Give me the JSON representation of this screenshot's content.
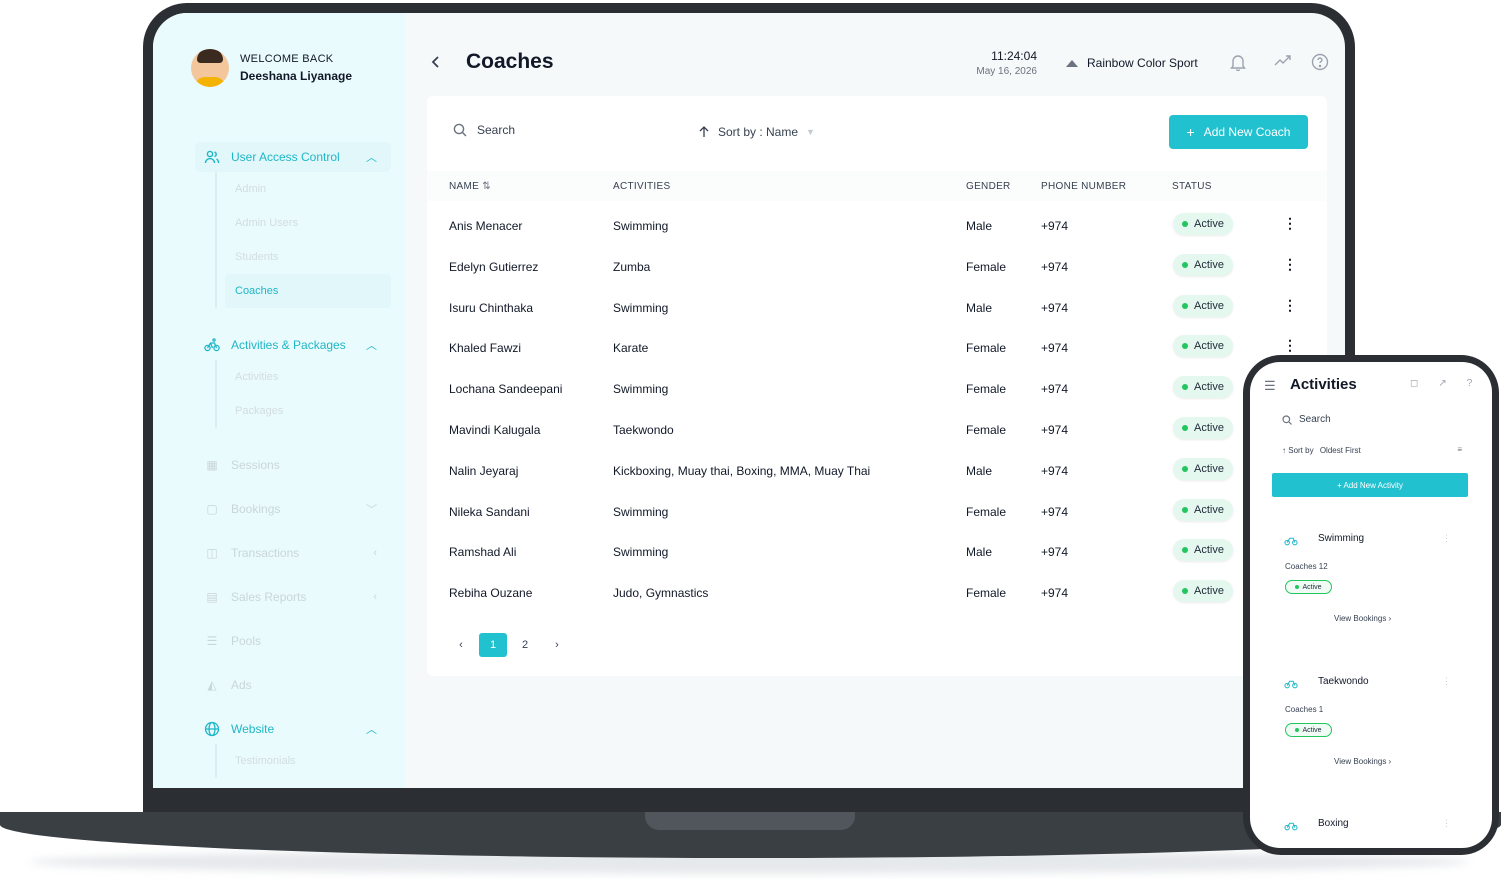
{
  "sidebar": {
    "welcome": "WELCOME BACK",
    "username": "Deeshana Liyanage",
    "groups": [
      {
        "label": "User Access Control",
        "icon": "users-icon",
        "sub": [
          "Admin",
          "Admin Users",
          "Students",
          "Coaches"
        ]
      },
      {
        "label": "Activities & Packages",
        "icon": "bike-icon",
        "sub": [
          "Activities",
          "Packages"
        ]
      },
      {
        "label": "Sessions",
        "icon": "grid-icon"
      },
      {
        "label": "Bookings",
        "icon": "calendar-icon"
      },
      {
        "label": "Transactions",
        "icon": "wallet-icon"
      },
      {
        "label": "Sales Reports",
        "icon": "report-icon"
      },
      {
        "label": "Pools",
        "icon": "list-icon"
      },
      {
        "label": "Ads",
        "icon": "megaphone-icon"
      },
      {
        "label": "Website",
        "icon": "globe-icon",
        "sub": [
          "Testimonials"
        ]
      }
    ]
  },
  "header": {
    "title": "Coaches",
    "time": "11:24:04",
    "date": "May 16, 2026",
    "org": "Rainbow Color Sport"
  },
  "toolbar": {
    "search_placeholder": "Search",
    "sort_label": "Sort by : Name",
    "add_label": "Add New Coach"
  },
  "table": {
    "columns": [
      "NAME",
      "ACTIVITIES",
      "GENDER",
      "PHONE NUMBER",
      "STATUS"
    ],
    "rows": [
      {
        "name": "Anis Menacer",
        "activities": "Swimming",
        "gender": "Male",
        "phone": "+974",
        "status": "Active"
      },
      {
        "name": "Edelyn Gutierrez",
        "activities": "Zumba",
        "gender": "Female",
        "phone": "+974",
        "status": "Active"
      },
      {
        "name": "Isuru Chinthaka",
        "activities": "Swimming",
        "gender": "Male",
        "phone": "+974",
        "status": "Active"
      },
      {
        "name": "Khaled Fawzi",
        "activities": "Karate",
        "gender": "Female",
        "phone": "+974",
        "status": "Active"
      },
      {
        "name": "Lochana Sandeepani",
        "activities": "Swimming",
        "gender": "Female",
        "phone": "+974",
        "status": "Active"
      },
      {
        "name": "Mavindi Kalugala",
        "activities": "Taekwondo",
        "gender": "Female",
        "phone": "+974",
        "status": "Active"
      },
      {
        "name": "Nalin Jeyaraj",
        "activities": "Kickboxing, Muay thai, Boxing, MMA, Muay Thai",
        "gender": "Male",
        "phone": "+974",
        "status": "Active"
      },
      {
        "name": "Nileka Sandani",
        "activities": "Swimming",
        "gender": "Female",
        "phone": "+974",
        "status": "Active"
      },
      {
        "name": "Ramshad Ali",
        "activities": "Swimming",
        "gender": "Male",
        "phone": "+974",
        "status": "Active"
      },
      {
        "name": "Rebiha Ouzane",
        "activities": "Judo, Gymnastics",
        "gender": "Female",
        "phone": "+974",
        "status": "Active"
      }
    ]
  },
  "pagination": {
    "prev": "‹",
    "pages": [
      "1",
      "2"
    ],
    "current": "1",
    "next": "›"
  },
  "phone": {
    "title": "Activities",
    "search_placeholder": "Search",
    "sort_label": "Sort by",
    "sort_value": "Oldest First",
    "add_label": "+ Add New Activity",
    "cards": [
      {
        "name": "Swimming",
        "coaches": "Coaches 12",
        "status": "Active",
        "view": "View Bookings"
      },
      {
        "name": "Taekwondo",
        "coaches": "Coaches 1",
        "status": "Active",
        "view": "View Bookings"
      },
      {
        "name": "Boxing"
      }
    ]
  },
  "colors": {
    "accent": "#22c1cf",
    "active_dot": "#22c55e",
    "sidebar_bg": "#eafbfd"
  }
}
